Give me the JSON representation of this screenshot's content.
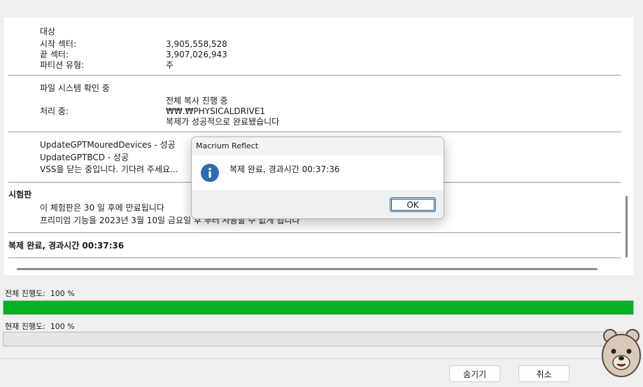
{
  "log": {
    "target": {
      "heading": "대상",
      "rows": [
        {
          "label": "시작 섹터:",
          "value": "3,905,558,528"
        },
        {
          "label": "끝 섹터:",
          "value": "3,907,026,943"
        },
        {
          "label": "파티션 유형:",
          "value": "주"
        }
      ]
    },
    "fscheck": {
      "heading": "파일 시스템 확인 중",
      "line1": "전체 복사 진행 중",
      "processing_label": "처리 중:",
      "processing_value": "₩₩.₩PHYSICALDRIVE1",
      "line3": "복제가 성공적으로 완료됐습니다"
    },
    "updates": {
      "line1": "UpdateGPTMouredDevices - 성공",
      "line2": "UpdateGPTBCD - 성공",
      "line3": "VSS을 닫는 중입니다. 기다려 주세요..."
    },
    "trial": {
      "heading": "시험판",
      "line1": "이 체험판은 30 일 후에 만료됩니다",
      "line2": "프리미엄 기능을 2023년 3월 10일 금요일 후 부터 사용할 수 없게 됩니다"
    },
    "complete": {
      "text": "복제 완료, 경과시간 00:37:36"
    }
  },
  "progress": {
    "overall_label": "전체 진행도:",
    "overall_value": "100 %",
    "overall_fraction": 1.0,
    "current_label": "현재 진행도:",
    "current_value": "100 %",
    "current_fraction": 0.0
  },
  "buttons": {
    "hide": "숨기기",
    "cancel": "취소"
  },
  "dialog": {
    "title": "Macrium Reflect",
    "message": "복제 완료, 경과시간 00:37:36",
    "ok": "OK",
    "icon": "info-icon"
  },
  "colors": {
    "progress_fill": "#06b025",
    "info_icon": "#2b6cb3"
  }
}
